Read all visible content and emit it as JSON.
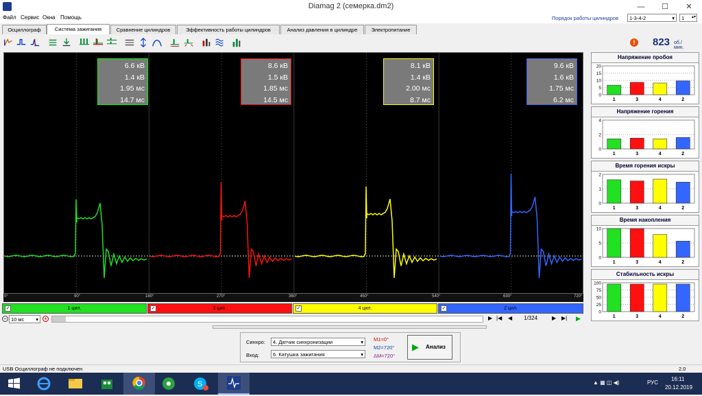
{
  "window": {
    "title": "Diamag 2 (семерка.dm2)",
    "minimize": "—",
    "maximize": "☐",
    "close": "✕"
  },
  "menu": [
    "Файл",
    "Сервис",
    "Окна",
    "Помощь"
  ],
  "cylinder_order": {
    "label": "Порядок работы цилиндров",
    "value": "1-3-4-2",
    "num": "1"
  },
  "tabs": [
    "Осциллограф",
    "Система зажигания",
    "Сравнение цилиндров",
    "Эффективность работы цилиндров",
    "Анализ давления в цилиндре",
    "Электропитание"
  ],
  "rpm": {
    "value": "823",
    "unit": "об./мин."
  },
  "info_boxes": [
    {
      "lines": [
        "6.6 кВ",
        "1.4 кВ",
        "1.95 мс",
        "14.7 мс"
      ],
      "color": "#00ff00"
    },
    {
      "lines": [
        "8.6 кВ",
        "1.5 кВ",
        "1.85 мс",
        "14.5 мс"
      ],
      "color": "#ff0000"
    },
    {
      "lines": [
        "8.1 кВ",
        "1.4 кВ",
        "2.00 мс",
        "8.7 мс"
      ],
      "color": "#ffff00"
    },
    {
      "lines": [
        "9.6 кВ",
        "1.6 кВ",
        "1.75 мс",
        "6.2 мс"
      ],
      "color": "#3366ff"
    }
  ],
  "degree_labels": [
    "0°",
    "90°",
    "180°",
    "270°",
    "360°",
    "450°",
    "540°",
    "630°",
    "720°"
  ],
  "cylinders": [
    {
      "label": "1 цил.",
      "color": "#22e022",
      "check": "✓"
    },
    {
      "label": "3 цил.",
      "color": "#ff1010",
      "check": "✓"
    },
    {
      "label": "4 цил.",
      "color": "#ffff00",
      "check": "✓"
    },
    {
      "label": "2 цил.",
      "color": "#3366ff",
      "check": "✓"
    }
  ],
  "nav": {
    "timebase": "10 мс",
    "frame": "1/324"
  },
  "side_panels": [
    {
      "title": "Напряжение пробоя",
      "yticks": [
        "20",
        "15",
        "10",
        "5",
        "0"
      ],
      "xlabels": [
        "1",
        "3",
        "4",
        "2"
      ],
      "values": [
        6.6,
        8.6,
        8.1,
        9.6
      ],
      "max": 20
    },
    {
      "title": "Напряжение горения",
      "yticks": [
        "4",
        "2",
        "0"
      ],
      "xlabels": [
        "1",
        "3",
        "4",
        "2"
      ],
      "values": [
        1.4,
        1.5,
        1.4,
        1.6
      ],
      "max": 4
    },
    {
      "title": "Время горения искры",
      "yticks": [
        "2",
        "1",
        "0"
      ],
      "xlabels": [
        "1",
        "3",
        "4",
        "2"
      ],
      "values": [
        1.95,
        1.85,
        2.0,
        1.75
      ],
      "max": 2.4
    },
    {
      "title": "Время накопления",
      "yticks": [
        "10",
        "5",
        "0"
      ],
      "xlabels": [
        "1",
        "3",
        "4",
        "2"
      ],
      "values": [
        14.7,
        14.5,
        8.7,
        6.2
      ],
      "max": 11
    },
    {
      "title": "Стабильность искры",
      "yticks": [
        "100",
        "75",
        "50",
        "25",
        "0"
      ],
      "xlabels": [
        "1",
        "3",
        "4",
        "2"
      ],
      "values": [
        100,
        100,
        100,
        100
      ],
      "max": 105
    }
  ],
  "bottom": {
    "sync_label": "Синхро:",
    "sync_value": "4. Датчик синхронизации",
    "input_label": "Вход:",
    "input_value": "6. Катушка зажигания",
    "m1": "M1=0°",
    "m2": "M2=720°",
    "dm": "ΔM=720°",
    "analyze": "Анализ"
  },
  "status": {
    "text": "USB Осциллограф не подключен",
    "version": "2.0"
  },
  "clock": {
    "time": "16:11",
    "date": "20.12.2019",
    "lang": "РУС"
  },
  "colors": {
    "green": "#22e022",
    "red": "#ff1010",
    "yellow": "#ffff00",
    "blue": "#3366ff"
  }
}
